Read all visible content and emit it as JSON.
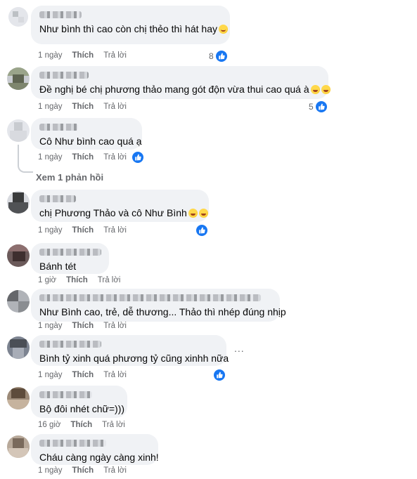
{
  "comments": [
    {
      "text": "Như bình thì cao còn chị thẻo thì hát hay",
      "emoji": "smile",
      "time": "1 ngày",
      "like": "Thích",
      "reply": "Trả lời",
      "reactions": "8"
    },
    {
      "text": "Đề nghị bé chị phương thảo mang gót độn vừa thui cao quá à",
      "emoji": "laugh2",
      "time": "1 ngày",
      "like": "Thích",
      "reply": "Trả lời",
      "reactions": "5"
    },
    {
      "text": "Cô Như bình cao quá ạ",
      "emoji": "",
      "time": "1 ngày",
      "like": "Thích",
      "reply": "Trả lời",
      "reactions": ""
    },
    {
      "text": "chị Phương Thảo và cô Như Bình",
      "emoji": "laugh2",
      "time": "1 ngày",
      "like": "Thích",
      "reply": "Trả lời",
      "reactions": ""
    },
    {
      "text": "Bánh tét",
      "emoji": "",
      "time": "1 giờ",
      "like": "Thích",
      "reply": "Trả lời",
      "reactions": ""
    },
    {
      "text": "Như Bình cao, trẻ, dễ thương... Thảo thì nhép đúng nhịp",
      "emoji": "",
      "time": "1 ngày",
      "like": "Thích",
      "reply": "Trả lời",
      "reactions": ""
    },
    {
      "text": "Bình tỷ xinh quá phương tỷ cũng xinhh nữa",
      "emoji": "",
      "time": "1 ngày",
      "like": "Thích",
      "reply": "Trả lời",
      "reactions": ""
    },
    {
      "text": "Bộ đôi nhét chữ=)))",
      "emoji": "",
      "time": "16 giờ",
      "like": "Thích",
      "reply": "Trả lời",
      "reactions": ""
    },
    {
      "text": "Cháu càng ngày càng xinh!",
      "emoji": "",
      "time": "1 ngày",
      "like": "Thích",
      "reply": "Trả lời",
      "reactions": ""
    }
  ],
  "view_replies": "Xem 1 phản hồi",
  "more_options": "...",
  "icons": {
    "reaction": "like-icon",
    "more": "more-options-icon"
  },
  "colors": {
    "bubble": "#f0f2f5",
    "like": "#1877f2",
    "meta": "#65676b"
  }
}
